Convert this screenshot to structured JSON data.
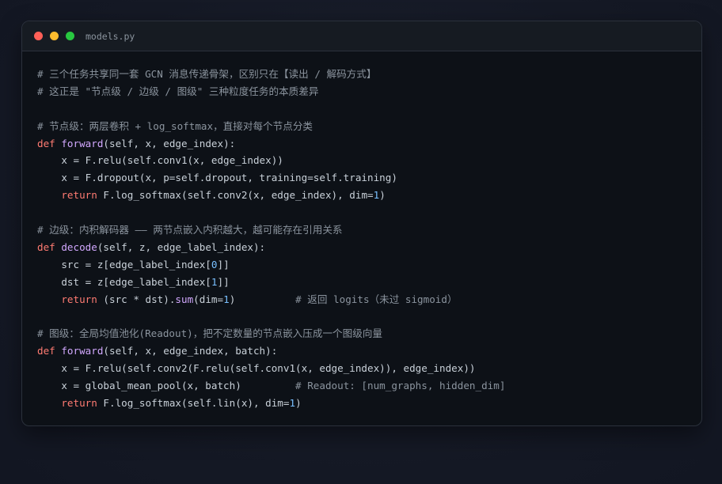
{
  "window": {
    "filename": "models.py"
  },
  "colors": {
    "comment": "#8b949e",
    "keyword": "#ff7b72",
    "function": "#d2a8ff",
    "number": "#79c0ff",
    "plain": "#c9d1d9",
    "close": "#ff5f57",
    "minimize": "#febc2e",
    "zoom": "#28c840"
  },
  "code_lines": [
    [
      {
        "t": "cm",
        "s": "# 三个任务共享同一套 GCN 消息传递骨架，区别只在【读出 / 解码方式】"
      }
    ],
    [
      {
        "t": "cm",
        "s": "# 这正是 \"节点级 / 边级 / 图级\" 三种粒度任务的本质差异"
      }
    ],
    [],
    [
      {
        "t": "cm",
        "s": "# 节点级：两层卷积 + log_softmax，直接对每个节点分类"
      }
    ],
    [
      {
        "t": "kw",
        "s": "def "
      },
      {
        "t": "fn",
        "s": "forward"
      },
      {
        "t": "pl",
        "s": "(self, x, edge_index):"
      }
    ],
    [
      {
        "t": "pl",
        "s": "    x = F.relu(self.conv1(x, edge_index))"
      }
    ],
    [
      {
        "t": "pl",
        "s": "    x = F.dropout(x, p=self.dropout, training=self.training)"
      }
    ],
    [
      {
        "t": "pl",
        "s": "    "
      },
      {
        "t": "kw",
        "s": "return"
      },
      {
        "t": "pl",
        "s": " F.log_softmax(self.conv2(x, edge_index), dim="
      },
      {
        "t": "num",
        "s": "1"
      },
      {
        "t": "pl",
        "s": ")"
      }
    ],
    [],
    [
      {
        "t": "cm",
        "s": "# 边级：内积解码器 —— 两节点嵌入内积越大，越可能存在引用关系"
      }
    ],
    [
      {
        "t": "kw",
        "s": "def "
      },
      {
        "t": "fn",
        "s": "decode"
      },
      {
        "t": "pl",
        "s": "(self, z, edge_label_index):"
      }
    ],
    [
      {
        "t": "pl",
        "s": "    src = z[edge_label_index["
      },
      {
        "t": "num",
        "s": "0"
      },
      {
        "t": "pl",
        "s": "]]"
      }
    ],
    [
      {
        "t": "pl",
        "s": "    dst = z[edge_label_index["
      },
      {
        "t": "num",
        "s": "1"
      },
      {
        "t": "pl",
        "s": "]]"
      }
    ],
    [
      {
        "t": "pl",
        "s": "    "
      },
      {
        "t": "kw",
        "s": "return"
      },
      {
        "t": "pl",
        "s": " (src * dst)."
      },
      {
        "t": "fn",
        "s": "sum"
      },
      {
        "t": "pl",
        "s": "(dim="
      },
      {
        "t": "num",
        "s": "1"
      },
      {
        "t": "pl",
        "s": ")          "
      },
      {
        "t": "cm",
        "s": "# 返回 logits（未过 sigmoid）"
      }
    ],
    [],
    [
      {
        "t": "cm",
        "s": "# 图级：全局均值池化(Readout)，把不定数量的节点嵌入压成一个图级向量"
      }
    ],
    [
      {
        "t": "kw",
        "s": "def "
      },
      {
        "t": "fn",
        "s": "forward"
      },
      {
        "t": "pl",
        "s": "(self, x, edge_index, batch):"
      }
    ],
    [
      {
        "t": "pl",
        "s": "    x = F.relu(self.conv2(F.relu(self.conv1(x, edge_index)), edge_index))"
      }
    ],
    [
      {
        "t": "pl",
        "s": "    x = global_mean_pool(x, batch)         "
      },
      {
        "t": "cm",
        "s": "# Readout: [num_graphs, hidden_dim]"
      }
    ],
    [
      {
        "t": "pl",
        "s": "    "
      },
      {
        "t": "kw",
        "s": "return"
      },
      {
        "t": "pl",
        "s": " F.log_softmax(self.lin(x), dim="
      },
      {
        "t": "num",
        "s": "1"
      },
      {
        "t": "pl",
        "s": ")"
      }
    ]
  ]
}
